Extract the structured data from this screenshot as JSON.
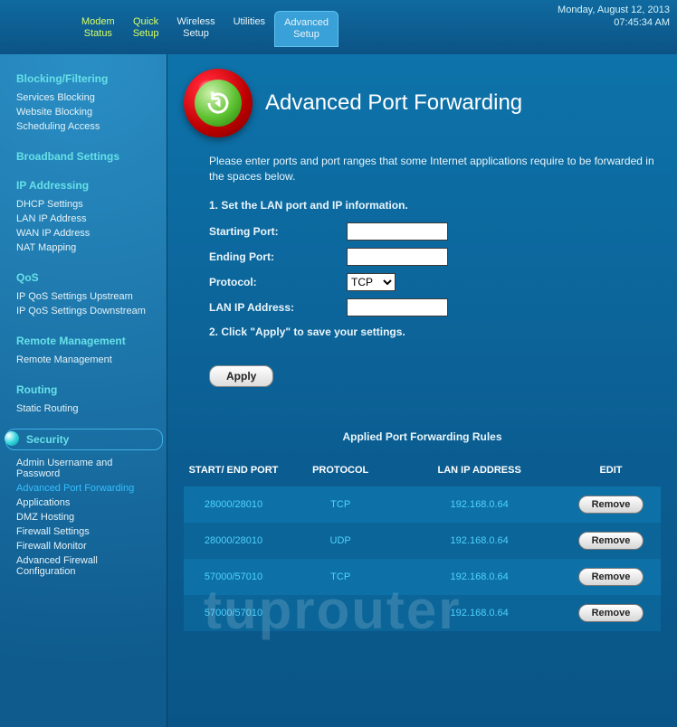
{
  "header": {
    "nav": [
      {
        "line1": "Modem",
        "line2": "Status"
      },
      {
        "line1": "Quick",
        "line2": "Setup"
      },
      {
        "line1": "Wireless",
        "line2": "Setup"
      },
      {
        "line1": "Utilities",
        "line2": ""
      },
      {
        "line1": "Advanced",
        "line2": "Setup"
      }
    ],
    "date": "Monday, August 12, 2013",
    "time": "07:45:34  AM"
  },
  "sidebar": {
    "sections": [
      {
        "title": "Blocking/Filtering",
        "items": [
          "Services Blocking",
          "Website Blocking",
          "Scheduling Access"
        ]
      },
      {
        "title": "Broadband Settings",
        "items": []
      },
      {
        "title": "IP Addressing",
        "items": [
          "DHCP Settings",
          "LAN IP Address",
          "WAN IP Address",
          "NAT Mapping"
        ]
      },
      {
        "title": "QoS",
        "items": [
          "IP QoS Settings Upstream",
          "IP QoS Settings Downstream"
        ]
      },
      {
        "title": "Remote Management",
        "items": [
          "Remote Management"
        ]
      },
      {
        "title": "Routing",
        "items": [
          "Static Routing"
        ]
      }
    ],
    "security_title": "Security",
    "security_items": [
      "Admin Username and Password",
      "Advanced Port Forwarding",
      "Applications",
      "DMZ Hosting",
      "Firewall Settings",
      "Firewall Monitor",
      "Advanced Firewall Configuration"
    ]
  },
  "main": {
    "title": "Advanced Port Forwarding",
    "intro": "Please enter ports and port ranges that some Internet applications require to be forwarded in the spaces below.",
    "step1": "1. Set the LAN port and IP information.",
    "labels": {
      "starting_port": "Starting Port:",
      "ending_port": "Ending Port:",
      "protocol": "Protocol:",
      "lan_ip": "LAN IP Address:"
    },
    "protocol_value": "TCP",
    "step2": "2. Click \"Apply\" to save your settings.",
    "apply_label": "Apply",
    "rules_title": "Applied Port Forwarding Rules",
    "table_headers": {
      "port": "START/ END PORT",
      "protocol": "PROTOCOL",
      "lanip": "LAN IP ADDRESS",
      "edit": "EDIT"
    },
    "remove_label": "Remove",
    "rules": [
      {
        "port": "28000/28010",
        "protocol": "TCP",
        "lanip": "192.168.0.64"
      },
      {
        "port": "28000/28010",
        "protocol": "UDP",
        "lanip": "192.168.0.64"
      },
      {
        "port": "57000/57010",
        "protocol": "TCP",
        "lanip": "192.168.0.64"
      },
      {
        "port": "57000/57010",
        "protocol": "",
        "lanip": "192.168.0.64"
      }
    ]
  },
  "watermark": "tuprouter"
}
